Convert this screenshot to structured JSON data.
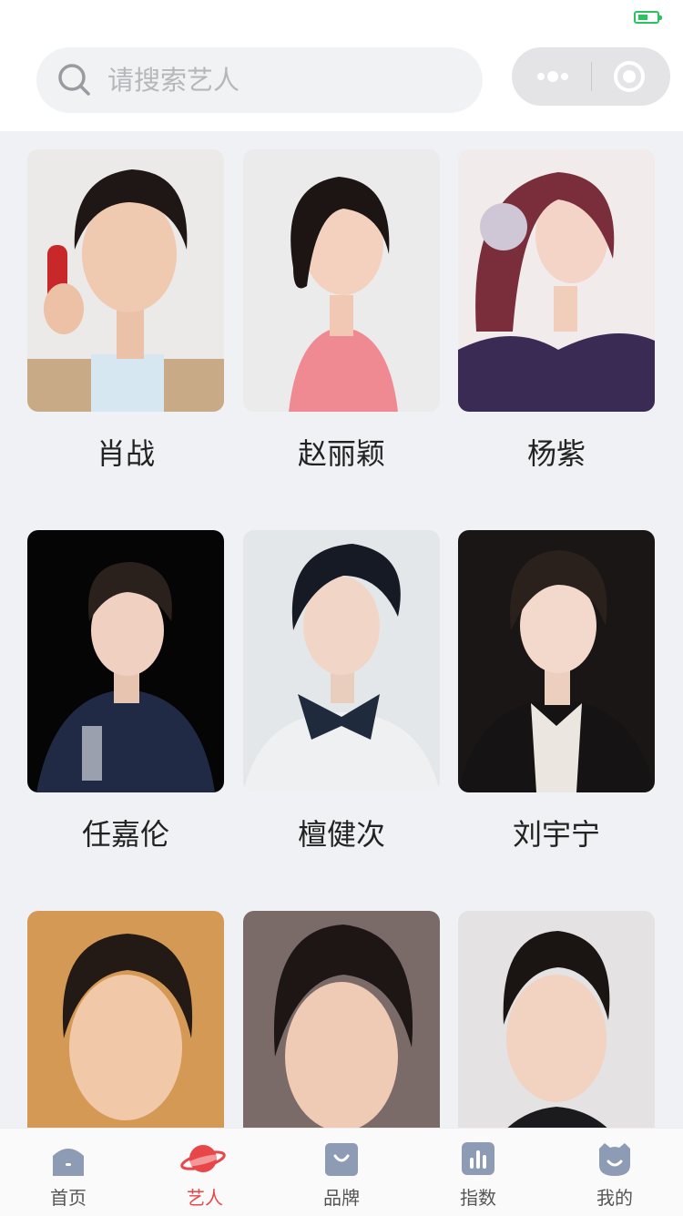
{
  "search": {
    "placeholder": "请搜索艺人"
  },
  "artists": [
    {
      "name": "肖战"
    },
    {
      "name": "赵丽颖"
    },
    {
      "name": "杨紫"
    },
    {
      "name": "任嘉伦"
    },
    {
      "name": "檀健次"
    },
    {
      "name": "刘宇宁"
    },
    {
      "name": ""
    },
    {
      "name": ""
    },
    {
      "name": ""
    }
  ],
  "tabs": [
    {
      "label": "首页",
      "icon": "home-icon",
      "active": false
    },
    {
      "label": "艺人",
      "icon": "planet-icon",
      "active": true
    },
    {
      "label": "品牌",
      "icon": "shopping-bag-icon",
      "active": false
    },
    {
      "label": "指数",
      "icon": "bar-chart-icon",
      "active": false
    },
    {
      "label": "我的",
      "icon": "profile-icon",
      "active": false
    }
  ],
  "colors": {
    "accent": "#e8474a",
    "tab_icon": "#8e9bb5",
    "battery": "#29c45f"
  }
}
